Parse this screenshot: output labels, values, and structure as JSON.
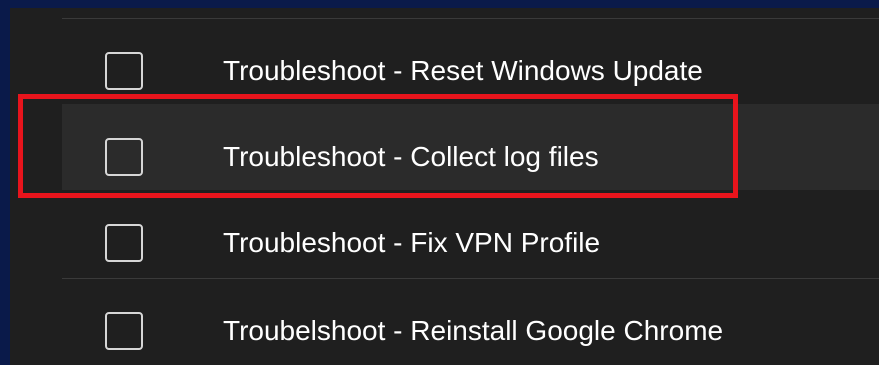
{
  "items": [
    {
      "label": "Troubleshoot - Reset Windows Update",
      "checked": false
    },
    {
      "label": "Troubleshoot - Collect log files",
      "checked": false
    },
    {
      "label": "Troubleshoot - Fix VPN Profile",
      "checked": false
    },
    {
      "label": "Troubelshoot - Reinstall Google Chrome",
      "checked": false
    }
  ],
  "colors": {
    "highlight_border": "#e8141c",
    "page_border": "#0a1a4a",
    "list_background": "#1f1f1f",
    "selected_row_background": "#2b2b2b"
  }
}
